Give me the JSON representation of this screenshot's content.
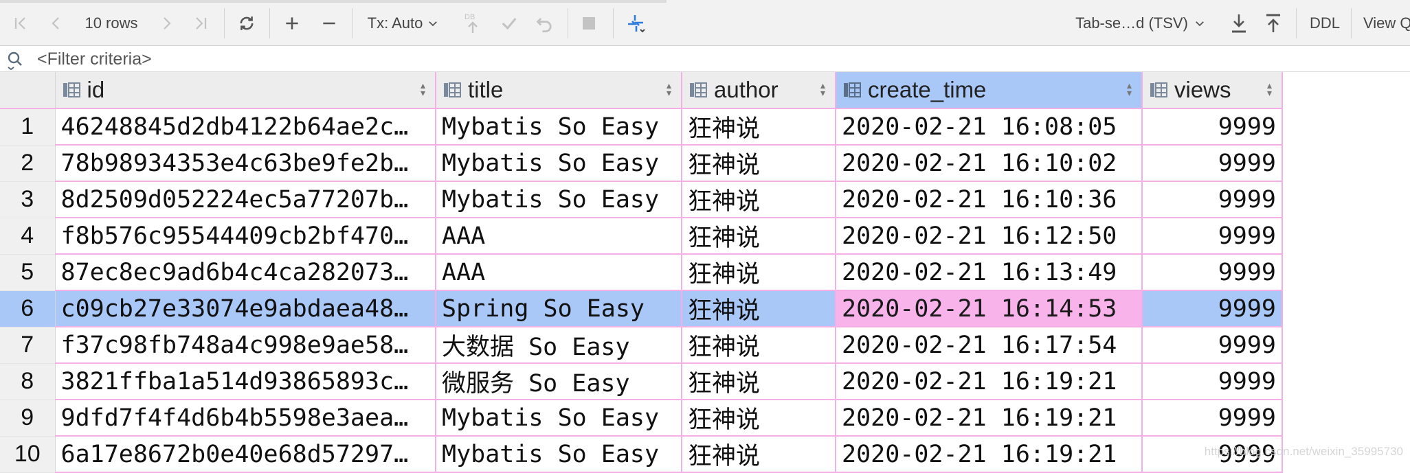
{
  "toolbar": {
    "rows_label": "10 rows",
    "tx_label": "Tx: Auto",
    "export_format_label": "Tab-se…d (TSV)",
    "ddl_label": "DDL",
    "view_label": "View Q"
  },
  "filter": {
    "placeholder": "<Filter criteria>"
  },
  "grid": {
    "columns": [
      "id",
      "title",
      "author",
      "create_time",
      "views"
    ],
    "selected_column": "create_time",
    "selected_row": 6,
    "rows": [
      {
        "n": "1",
        "id": "46248845d2db4122b64ae2c…",
        "title": "Mybatis So Easy",
        "author": "狂神说",
        "create_time": "2020-02-21 16:08:05",
        "views": "9999"
      },
      {
        "n": "2",
        "id": "78b98934353e4c63be9fe2b…",
        "title": "Mybatis So Easy",
        "author": "狂神说",
        "create_time": "2020-02-21 16:10:02",
        "views": "9999"
      },
      {
        "n": "3",
        "id": "8d2509d052224ec5a77207b…",
        "title": "Mybatis So Easy",
        "author": "狂神说",
        "create_time": "2020-02-21 16:10:36",
        "views": "9999"
      },
      {
        "n": "4",
        "id": "f8b576c95544409cb2bf470…",
        "title": "AAA",
        "author": "狂神说",
        "create_time": "2020-02-21 16:12:50",
        "views": "9999"
      },
      {
        "n": "5",
        "id": "87ec8ec9ad6b4c4ca282073…",
        "title": "AAA",
        "author": "狂神说",
        "create_time": "2020-02-21 16:13:49",
        "views": "9999"
      },
      {
        "n": "6",
        "id": "c09cb27e33074e9abdaea48…",
        "title": "Spring So Easy",
        "author": "狂神说",
        "create_time": "2020-02-21 16:14:53",
        "views": "9999"
      },
      {
        "n": "7",
        "id": "f37c98fb748a4c998e9ae58…",
        "title": "大数据 So Easy",
        "author": "狂神说",
        "create_time": "2020-02-21 16:17:54",
        "views": "9999"
      },
      {
        "n": "8",
        "id": "3821ffba1a514d93865893c…",
        "title": "微服务 So Easy",
        "author": "狂神说",
        "create_time": "2020-02-21 16:19:21",
        "views": "9999"
      },
      {
        "n": "9",
        "id": "9dfd7f4f4d6b4b5598e3aea…",
        "title": "Mybatis So Easy",
        "author": "狂神说",
        "create_time": "2020-02-21 16:19:21",
        "views": "9999"
      },
      {
        "n": "10",
        "id": "6a17e8672b0e40e68d57297…",
        "title": "Mybatis So Easy",
        "author": "狂神说",
        "create_time": "2020-02-21 16:19:21",
        "views": "9999"
      }
    ]
  },
  "watermark": "https://blog.csdn.net/weixin_35995730",
  "colors": {
    "selection": "#a9c7f7",
    "current_cell": "#f7b3ea",
    "grid_line": "#f4b0e6"
  }
}
